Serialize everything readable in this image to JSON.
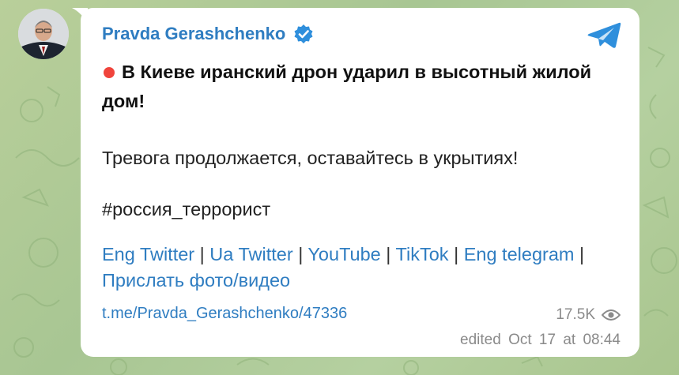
{
  "channel": {
    "name": "Pravda Gerashchenko",
    "verified": true
  },
  "post": {
    "headline": "В Киеве иранский дрон ударил в высотный жилой дом!",
    "line2": "Тревога продолжается, оставайтесь в укрытиях!",
    "hashtag": "#россия_террорист",
    "links": [
      {
        "label": "Eng Twitter"
      },
      {
        "label": "Ua Twitter"
      },
      {
        "label": "YouTube"
      },
      {
        "label": "TikTok"
      },
      {
        "label": "Eng telegram"
      },
      {
        "label": "Прислать фото/видео"
      }
    ],
    "separator": "|",
    "permalink": "t.me/Pravda_Gerashchenko/47336",
    "views": "17.5K",
    "edited": "edited",
    "timestamp": "Oct 17 at 08:44"
  },
  "colors": {
    "link": "#2f7dc1",
    "accent_dot": "#f0443c",
    "verified_badge": "#2f8fdc",
    "telegram_logo": "#2f8fdc",
    "meta_text": "#8a8a8a"
  },
  "icons": {
    "status": "red-circle-icon",
    "verified": "verified-badge-icon",
    "app": "telegram-logo-icon",
    "views": "eye-icon"
  }
}
